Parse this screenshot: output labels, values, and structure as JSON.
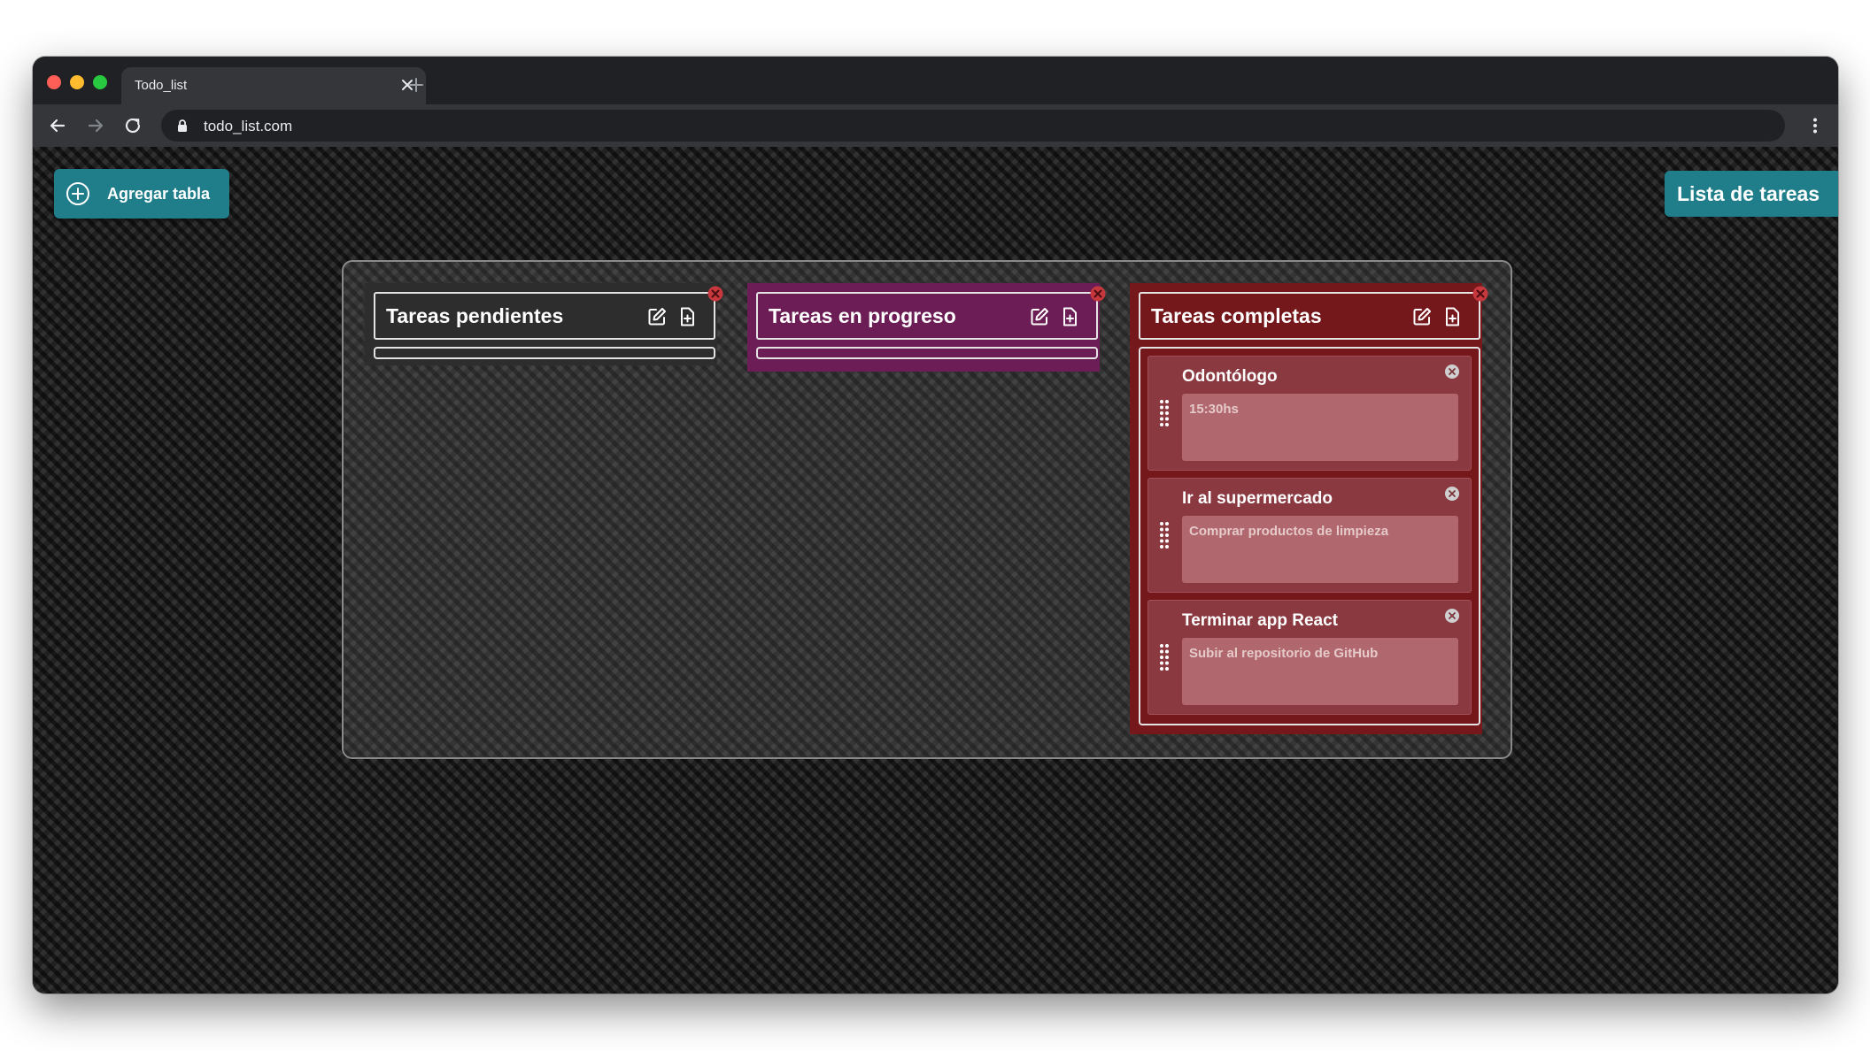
{
  "browser": {
    "tab_title": "Todo_list",
    "url": "todo_list.com",
    "colors": {
      "frame": "#202124",
      "toolbar": "#35363a",
      "text": "#e8eaed"
    },
    "icons": [
      "close-icon",
      "plus-icon",
      "back-arrow-icon",
      "forward-arrow-icon",
      "reload-icon",
      "lock-icon",
      "kebab-menu-icon"
    ]
  },
  "app": {
    "add_table_label": "Agregar tabla",
    "page_heading": "Lista de tareas",
    "accent_color": "#1f7e89",
    "columns": [
      {
        "title": "Tareas pendientes",
        "color": "#2d2d2d",
        "cards": []
      },
      {
        "title": "Tareas en progreso",
        "color": "#6c1d55",
        "cards": []
      },
      {
        "title": "Tareas completas",
        "color": "#75181c",
        "cards": [
          {
            "title": "Odontólogo",
            "description": "15:30hs"
          },
          {
            "title": "Ir al supermercado",
            "description": "Comprar productos de limpieza"
          },
          {
            "title": "Terminar app React",
            "description": "Subir al repositorio de GitHub"
          }
        ]
      }
    ]
  }
}
